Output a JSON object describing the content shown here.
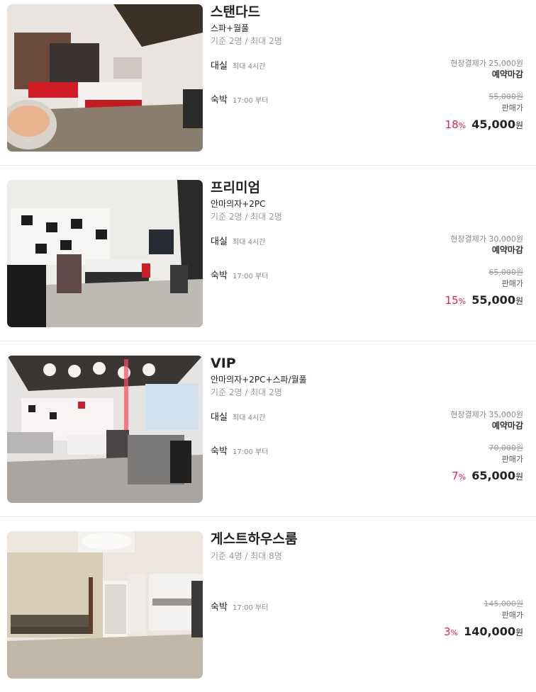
{
  "rooms": [
    {
      "name": "스탠다드",
      "feature": "스파+월풀",
      "capacity": "기준 2명 / 최대 2명",
      "rental": {
        "label": "대실",
        "max": "최대 4시간",
        "onsite": "현장결제가 25,000원",
        "status": "예약마감"
      },
      "stay": {
        "label": "숙박",
        "checkin": "17:00 부터",
        "original": "55,000원",
        "sale_label": "판매가",
        "discount": "18",
        "discount_unit": "%",
        "price": "45,000",
        "currency": "원"
      }
    },
    {
      "name": "프리미엄",
      "feature": "안마의자+2PC",
      "capacity": "기준 2명 / 최대 2명",
      "rental": {
        "label": "대실",
        "max": "최대 4시간",
        "onsite": "현장결제가 30,000원",
        "status": "예약마감"
      },
      "stay": {
        "label": "숙박",
        "checkin": "17:00 부터",
        "original": "65,000원",
        "sale_label": "판매가",
        "discount": "15",
        "discount_unit": "%",
        "price": "55,000",
        "currency": "원"
      }
    },
    {
      "name": "VIP",
      "feature": "안마의자+2PC+스파/월풀",
      "capacity": "기준 2명 / 최대 2명",
      "rental": {
        "label": "대실",
        "max": "최대 4시간",
        "onsite": "현장결제가 35,000원",
        "status": "예약마감"
      },
      "stay": {
        "label": "숙박",
        "checkin": "17:00 부터",
        "original": "70,000원",
        "sale_label": "판매가",
        "discount": "7",
        "discount_unit": "%",
        "price": "65,000",
        "currency": "원"
      }
    },
    {
      "name": "게스트하우스룸",
      "feature": "",
      "capacity": "기준 4명 / 최대 8명",
      "stay": {
        "label": "숙박",
        "checkin": "17:00 부터",
        "original": "145,000원",
        "sale_label": "판매가",
        "discount": "3",
        "discount_unit": "%",
        "price": "140,000",
        "currency": "원"
      }
    }
  ],
  "colors": {
    "discount": "#e5204d",
    "divider": "#ebebeb",
    "muted": "#999999"
  }
}
